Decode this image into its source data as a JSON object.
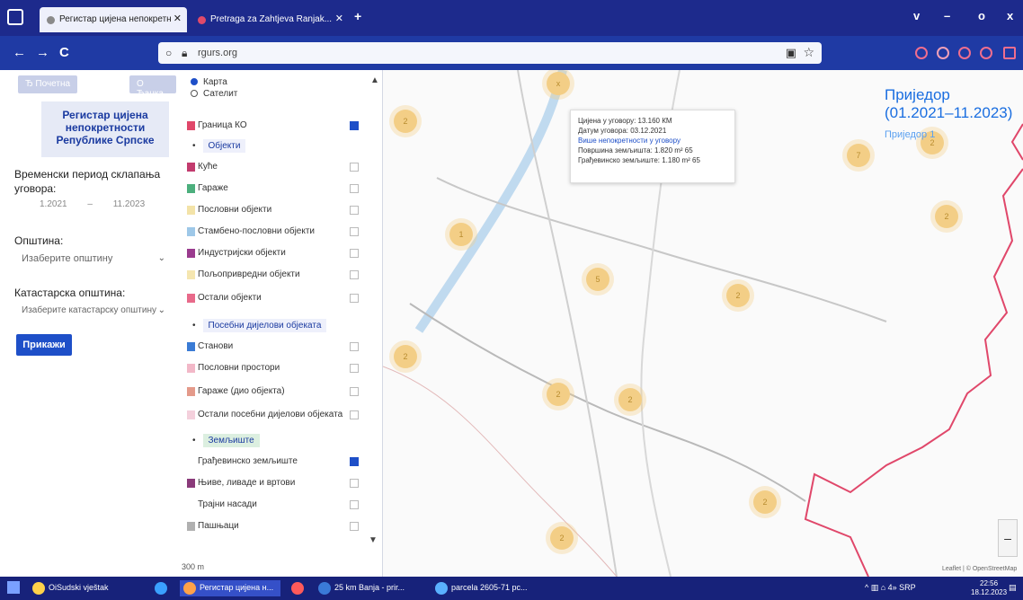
{
  "browser": {
    "tabs": [
      {
        "label": "Регистар цијена непокретн",
        "active": true
      },
      {
        "label": "Pretraga za Zahtjeva Ranjak...",
        "active": false
      }
    ],
    "new_tab": "+",
    "window_controls": [
      "v",
      "–",
      "o",
      "x"
    ],
    "url": "rgurs.org",
    "nav": {
      "back": "←",
      "forward": "→",
      "reload": "C"
    }
  },
  "left_panel": {
    "button_1": "Ђ Почетна",
    "button_2": "О Ђанка",
    "title": "Регистар цијена непокретности Републике Српске",
    "period_label": "Временски период склапања уговора:",
    "date_from": "1.2021",
    "date_sep": "–",
    "date_to": "11.2023",
    "municipality_label": "Општина:",
    "municipality_placeholder": "Изаберите општину",
    "cadastral_label": "Катастарска општина:",
    "cadastral_placeholder": "Изаберите катастарску општину",
    "show_button": "Прикажи"
  },
  "layers": {
    "base": [
      {
        "label": "Карта",
        "selected": true
      },
      {
        "label": "Сателит",
        "selected": false
      }
    ],
    "items": [
      {
        "kind": "row",
        "label": "Граница КО",
        "color": "#e0476a",
        "checked": true
      },
      {
        "kind": "section",
        "label": "Објекти",
        "color": "#eef0fb"
      },
      {
        "kind": "row",
        "label": "Куће",
        "color": "#c23b6e",
        "checked": false
      },
      {
        "kind": "row",
        "label": "Гараже",
        "color": "#4caf7d",
        "checked": false
      },
      {
        "kind": "row",
        "label": "Пословни објекти",
        "color": "#f3e3a8",
        "checked": false
      },
      {
        "kind": "row",
        "label": "Стамбено-пословни објекти",
        "color": "#9ec8e8",
        "checked": false
      },
      {
        "kind": "row",
        "label": "Индустријски објекти",
        "color": "#9a3b8e",
        "checked": false
      },
      {
        "kind": "row",
        "label": "Пољопривредни објекти",
        "color": "#f5e6b0",
        "checked": false
      },
      {
        "kind": "row",
        "label": "Остали објекти",
        "color": "#e86a8a",
        "checked": false
      },
      {
        "kind": "section",
        "label": "Посебни дијелови објеката",
        "color": "#eef0fb"
      },
      {
        "kind": "row",
        "label": "Станови",
        "color": "#3a7bd5",
        "checked": false
      },
      {
        "kind": "row",
        "label": "Пословни простори",
        "color": "#f2b8c8",
        "checked": false
      },
      {
        "kind": "row",
        "label": "Гараже (дио објекта)",
        "color": "#e49a8a",
        "checked": false
      },
      {
        "kind": "row",
        "label": "Остали посебни дијелови објеката",
        "color": "#f4d0dc",
        "checked": false
      },
      {
        "kind": "section",
        "label": "Земљиште",
        "color": "#dcefe0"
      },
      {
        "kind": "row",
        "label": "Грађевинско земљиште",
        "color": "#ffffff",
        "checked": true
      },
      {
        "kind": "row",
        "label": "Њиве, ливаде и вртови",
        "color": "#8a3a7a",
        "checked": false
      },
      {
        "kind": "row",
        "label": "Трајни насади",
        "color": "#ffffff",
        "checked": false
      },
      {
        "kind": "row",
        "label": "Пашњаци",
        "color": "#b0b0b0",
        "checked": false
      }
    ],
    "scale": "300 m"
  },
  "map": {
    "title": "Приједор (01.2021–11.2023)",
    "subtitle": "Приједор 1",
    "popup": {
      "line1": "Цијена у уговору: 13.160 КМ",
      "line2": "Датум уговора: 03.12.2021",
      "line3": "Више непокретности у уговору",
      "line4": "Површина земљишта: 1.820 m² 65",
      "line5": "Грађевинско земљиште: 1.180 m² 65"
    },
    "clusters": [
      "x",
      "2",
      "7",
      "1",
      "5",
      "2",
      "2",
      "2",
      "2",
      "2",
      "2",
      "2",
      "2"
    ],
    "zoom_out": "–",
    "attribution": "Leaflet | © OpenStreetMap"
  },
  "taskbar": {
    "buttons": [
      {
        "label": "OiSudski vještak",
        "active": false,
        "color": "#ffd24a"
      },
      {
        "label": "",
        "active": false,
        "color": "#3aa0ff"
      },
      {
        "label": "Регистар цијена н...",
        "active": true,
        "color": "#ffa24a"
      },
      {
        "label": "",
        "active": false,
        "color": "#ff5a5a"
      },
      {
        "label": "25 km Banja - prir...",
        "active": false,
        "color": "#3a7ad8"
      },
      {
        "label": "parcela 2605-71 pc...",
        "active": false,
        "color": "#5ab0ff"
      }
    ],
    "tray": "^ ▥ ⌂ 4» SRP",
    "time": "22:56",
    "date": "18.12.2023"
  }
}
